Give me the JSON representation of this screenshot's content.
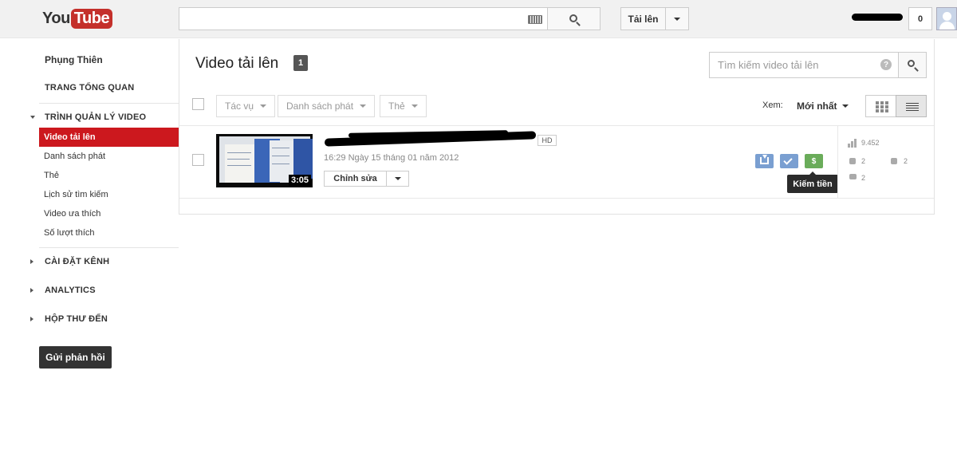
{
  "masthead": {
    "logo_you": "You",
    "logo_tube": "Tube",
    "search_value": "",
    "upload_label": "Tải lên",
    "notification_count": "0"
  },
  "sidebar": {
    "username": "Phụng Thiên",
    "dashboard": "TRANG TỔNG QUAN",
    "video_manager": "TRÌNH QUẢN LÝ VIDEO",
    "items": [
      {
        "label": "Video tải lên",
        "active": true
      },
      {
        "label": "Danh sách phát"
      },
      {
        "label": "Thẻ"
      },
      {
        "label": "Lịch sử tìm kiếm"
      },
      {
        "label": "Video ưa thích"
      },
      {
        "label": "Số lượt thích"
      }
    ],
    "channel_settings": "CÀI ĐẶT KÊNH",
    "analytics": "ANALYTICS",
    "inbox": "HỘP THƯ ĐẾN",
    "feedback": "Gửi phản hồi"
  },
  "main": {
    "title": "Video tải lên",
    "count": "1",
    "search_placeholder": "Tìm kiếm video tải lên",
    "help_glyph": "?",
    "toolbar": {
      "actions": "Tác vụ",
      "playlists": "Danh sách phát",
      "tags": "Thẻ",
      "view_label": "Xem:",
      "sort_value": "Mới nhất"
    },
    "video": {
      "duration": "3:05",
      "hd": "HD",
      "date": "16:29 Ngày 15 tháng 01 năm 2012",
      "edit": "Chỉnh sửa",
      "monetize_glyph": "$",
      "tooltip": "Kiếm tiền",
      "views": "9.452",
      "likes": "2",
      "dislikes": "2",
      "comments": "2"
    }
  },
  "colors": {
    "brand_red": "#cc181e",
    "monetize_green": "#6aac5a",
    "action_blue": "#7a9fd1"
  }
}
